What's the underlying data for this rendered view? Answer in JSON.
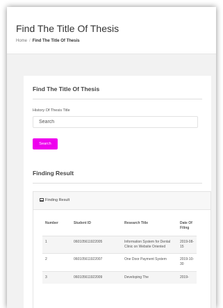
{
  "header": {
    "title": "Find The Title Of Thesis",
    "breadcrumb": {
      "home": "Home",
      "separator": "/",
      "current": "Find The Title Of Thesis"
    }
  },
  "search_section": {
    "title": "Find The Title Of Thesis",
    "field_label": "History Of Thesis Title",
    "placeholder": "Search",
    "button_label": "Search",
    "button_color": "#ee00ee"
  },
  "results_section": {
    "title": "Finding Result",
    "panel_title": "Finding Result",
    "panel_icon": "table-icon",
    "columns": [
      "Number",
      "Student ID",
      "Research Title",
      "Date Of Filing"
    ],
    "rows": [
      {
        "number": "1",
        "student_id": "060105611922005",
        "title": "Information System for Dental Clinic on Website Oriented",
        "date": "2019-08-15"
      },
      {
        "number": "2",
        "student_id": "060105611922007",
        "title": "One Door Payment System",
        "date": "2019-10-30"
      },
      {
        "number": "3",
        "student_id": "060105611922009",
        "title": "Developing The",
        "date": "2019-"
      }
    ]
  }
}
